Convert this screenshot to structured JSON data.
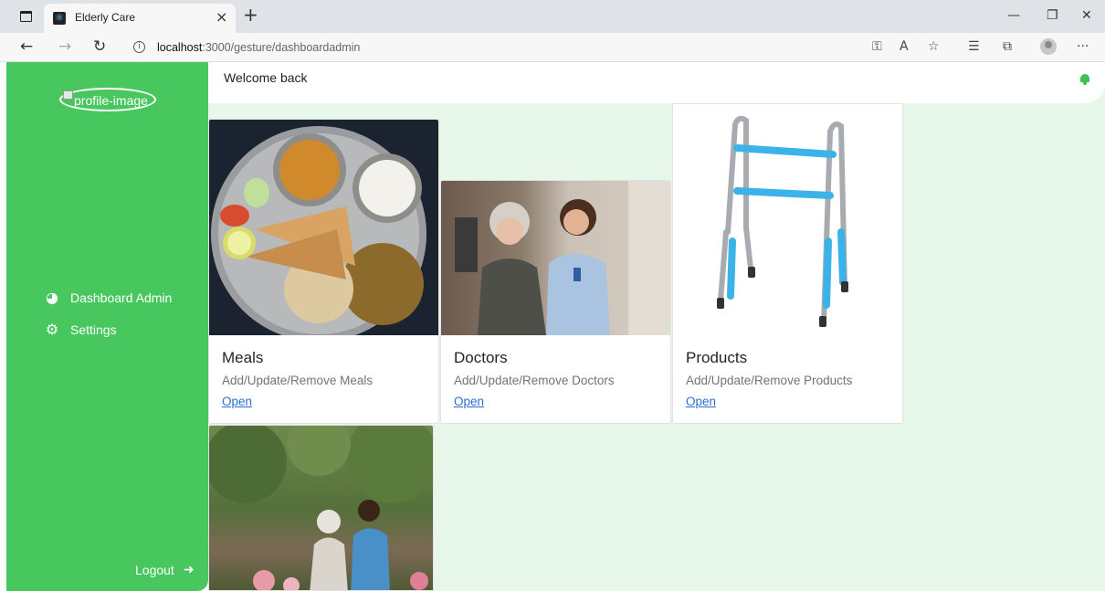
{
  "browser": {
    "tab_title": "Elderly Care",
    "url_host": "localhost",
    "url_path": ":3000/gesture/dashboardadmin"
  },
  "sidebar": {
    "profile_alt": "profile-image",
    "items": [
      {
        "label": "Dashboard Admin",
        "icon": "dashboard-gauge-icon"
      },
      {
        "label": "Settings",
        "icon": "gears-icon"
      }
    ],
    "logout_label": "Logout"
  },
  "header": {
    "welcome": "Welcome back",
    "bell_icon": "bell-icon"
  },
  "cards": [
    {
      "title": "Meals",
      "subtitle": "Add/Update/Remove Meals",
      "link": "Open"
    },
    {
      "title": "Doctors",
      "subtitle": "Add/Update/Remove Doctors",
      "link": "Open"
    },
    {
      "title": "Products",
      "subtitle": "Add/Update/Remove Products",
      "link": "Open"
    }
  ],
  "colors": {
    "sidebar": "#47c75d",
    "main_bg": "#e7f7e9",
    "link": "#2d6fd6"
  }
}
